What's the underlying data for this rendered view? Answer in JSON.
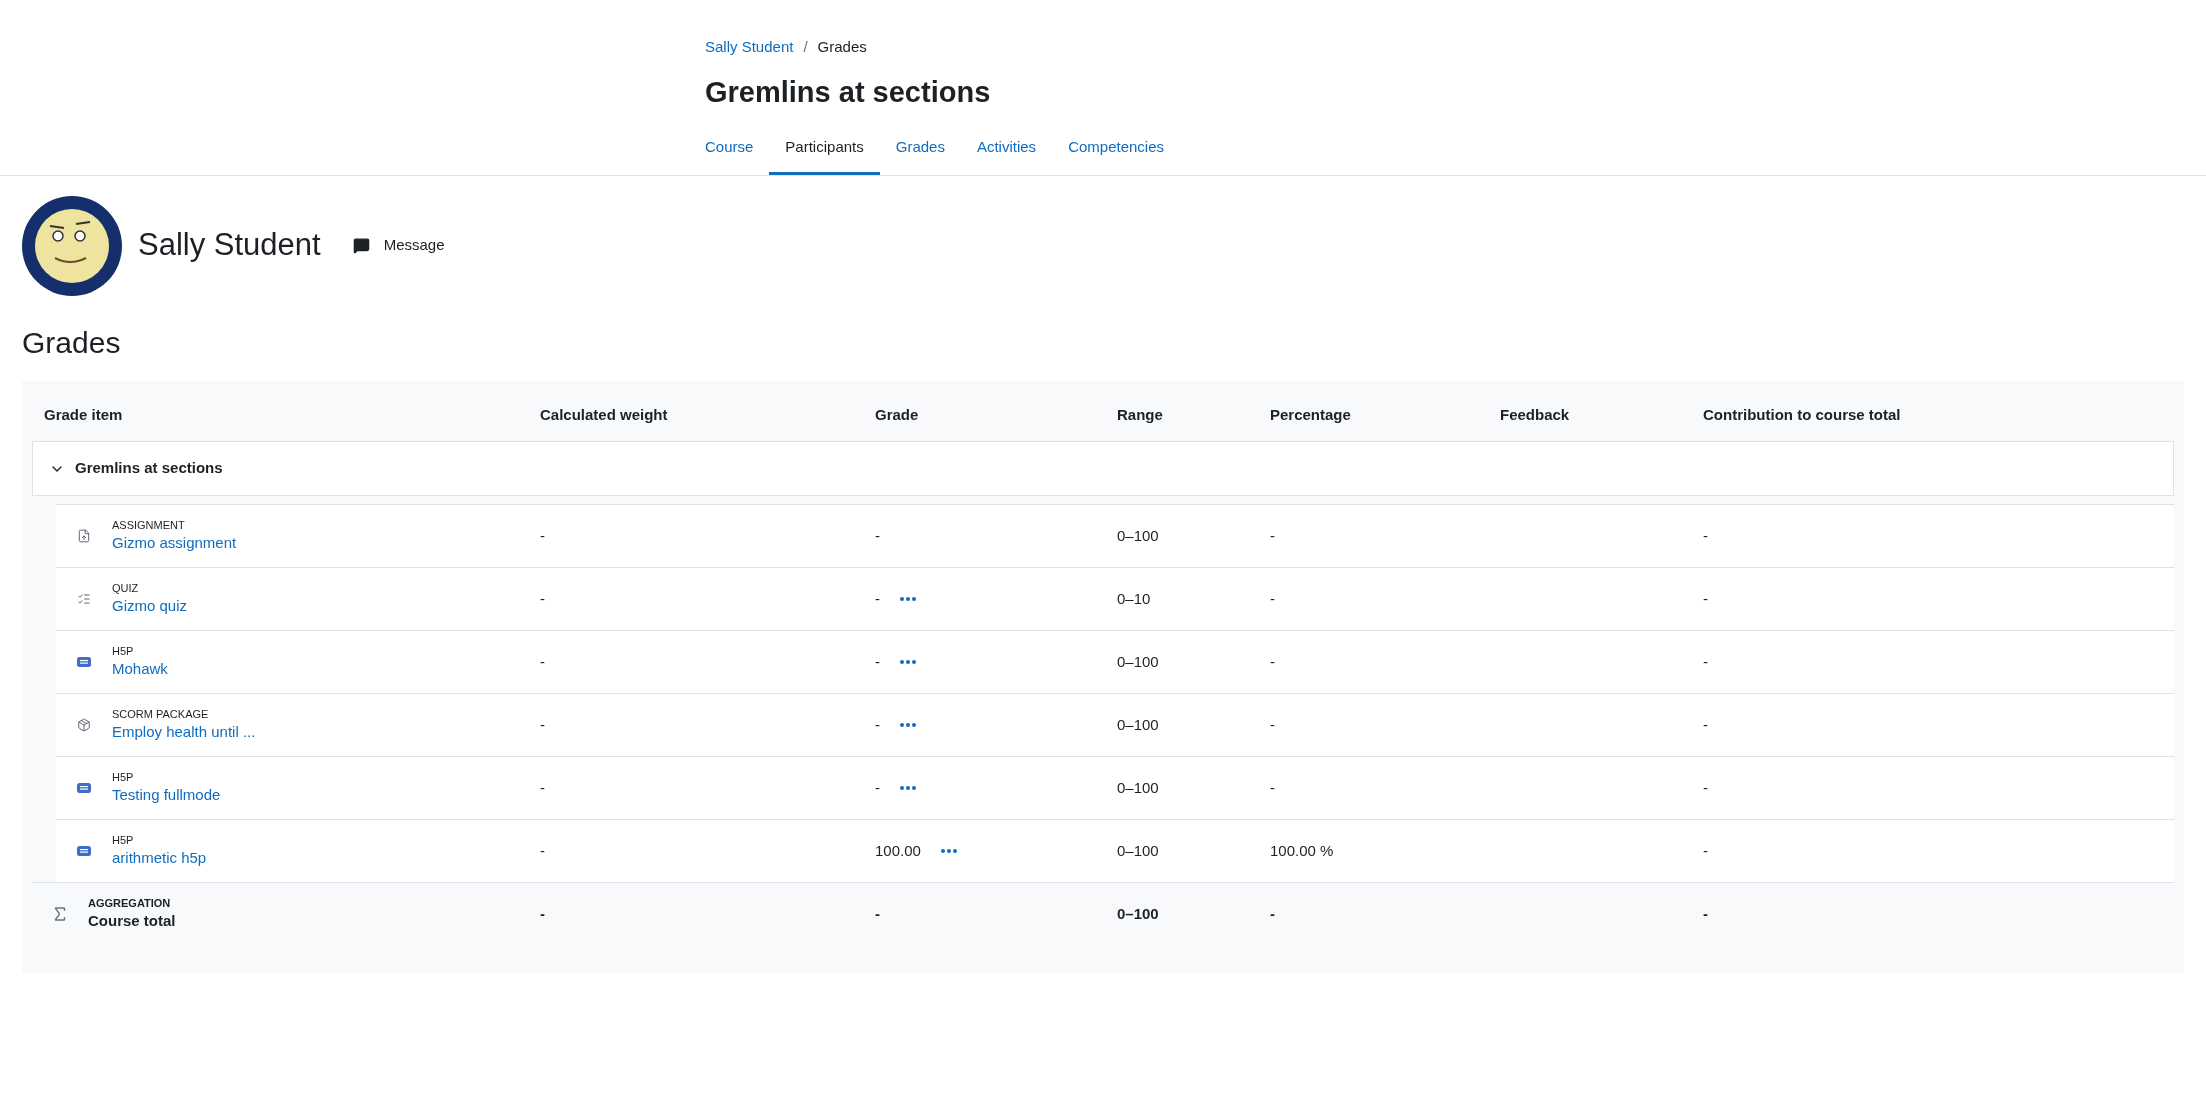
{
  "breadcrumb": [
    {
      "label": "Sally Student",
      "link": true
    },
    {
      "label": "Grades",
      "link": false
    }
  ],
  "breadcrumb_separator": "/",
  "page_title": "Gremlins at sections",
  "tabs": [
    {
      "label": "Course",
      "selected": false
    },
    {
      "label": "Participants",
      "selected": true
    },
    {
      "label": "Grades",
      "selected": false
    },
    {
      "label": "Activities",
      "selected": false
    },
    {
      "label": "Competencies",
      "selected": false
    }
  ],
  "user": {
    "name": "Sally Student",
    "message_button": "Message"
  },
  "section_heading": "Grades",
  "table": {
    "columns": [
      "Grade item",
      "Calculated weight",
      "Grade",
      "Range",
      "Percentage",
      "Feedback",
      "Contribution to course total"
    ],
    "category": {
      "name": "Gremlins at sections",
      "expanded": true
    },
    "rows": [
      {
        "kind": "assignment",
        "type_label": "ASSIGNMENT",
        "name": "Gizmo assignment",
        "weight": "-",
        "grade": "-",
        "grade_menu": false,
        "range": "0–100",
        "percentage": "-",
        "contribution": "-"
      },
      {
        "kind": "quiz",
        "type_label": "QUIZ",
        "name": "Gizmo quiz",
        "weight": "-",
        "grade": "-",
        "grade_menu": true,
        "range": "0–10",
        "percentage": "-",
        "contribution": "-"
      },
      {
        "kind": "h5p",
        "type_label": "H5P",
        "name": "Mohawk",
        "weight": "-",
        "grade": "-",
        "grade_menu": true,
        "range": "0–100",
        "percentage": "-",
        "contribution": "-"
      },
      {
        "kind": "scorm",
        "type_label": "SCORM PACKAGE",
        "name": "Employ health until ...",
        "weight": "-",
        "grade": "-",
        "grade_menu": true,
        "range": "0–100",
        "percentage": "-",
        "contribution": "-"
      },
      {
        "kind": "h5p",
        "type_label": "H5P",
        "name": "Testing fullmode",
        "weight": "-",
        "grade": "-",
        "grade_menu": true,
        "range": "0–100",
        "percentage": "-",
        "contribution": "-"
      },
      {
        "kind": "h5p",
        "type_label": "H5P",
        "name": "arithmetic h5p",
        "weight": "-",
        "grade": "100.00",
        "grade_menu": true,
        "range": "0–100",
        "percentage": "100.00 %",
        "contribution": "-"
      }
    ],
    "total": {
      "type_label": "AGGREGATION",
      "name": "Course total",
      "weight": "-",
      "grade": "-",
      "range": "0–100",
      "percentage": "-",
      "contribution": "-"
    }
  }
}
